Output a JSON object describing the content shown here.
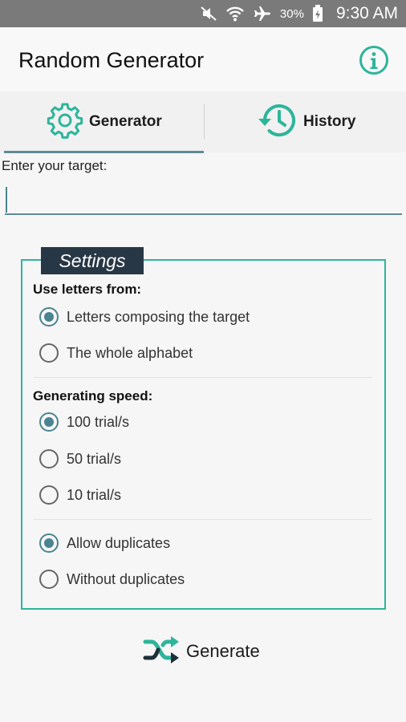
{
  "status_bar": {
    "icons": [
      "mute-icon",
      "wifi-icon",
      "airplane-icon",
      "battery-icon"
    ],
    "battery": "30%",
    "time": "9:30 AM"
  },
  "app": {
    "title": "Random Generator",
    "accent_color": "#2db59b",
    "primary_color": "#4a8492"
  },
  "tabs": [
    {
      "label": "Generator",
      "icon": "gear-icon",
      "selected": true
    },
    {
      "label": "History",
      "icon": "history-icon",
      "selected": false
    }
  ],
  "target": {
    "label": "Enter your target:",
    "value": ""
  },
  "settings": {
    "title": "Settings",
    "letters_heading": "Use letters from:",
    "letters_options": [
      {
        "label": "Letters composing the target",
        "checked": true
      },
      {
        "label": "The whole alphabet",
        "checked": false
      }
    ],
    "speed_heading": "Generating speed:",
    "speed_options": [
      {
        "label": "100 trial/s",
        "checked": true
      },
      {
        "label": "50 trial/s",
        "checked": false
      },
      {
        "label": "10 trial/s",
        "checked": false
      }
    ],
    "duplicate_options": [
      {
        "label": "Allow duplicates",
        "checked": true
      },
      {
        "label": "Without duplicates",
        "checked": false
      }
    ]
  },
  "generate": {
    "label": "Generate",
    "icon": "shuffle-icon"
  }
}
